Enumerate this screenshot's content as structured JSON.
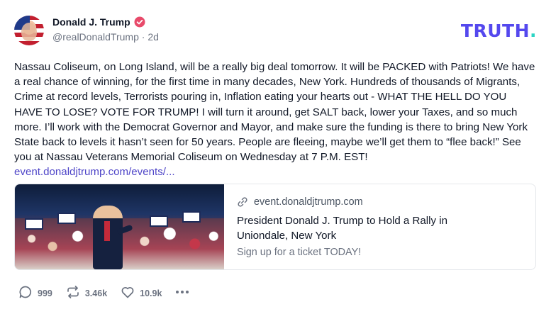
{
  "author": {
    "display_name": "Donald J. Trump",
    "handle": "@realDonaldTrump",
    "age": "2d",
    "verified": true,
    "verified_color": "#e84a6a"
  },
  "brand": {
    "name": "TRUTH",
    "dot": ".",
    "color": "#5448ee",
    "dot_color": "#2bd4c4"
  },
  "post": {
    "text": "Nassau Coliseum, on Long Island, will be a really big deal tomorrow. It will be PACKED with Patriots! We have a real chance of winning, for the first time in many decades, New York. Hundreds of thousands of Migrants, Crime at record levels, Terrorists pouring in, Inflation eating your hearts out - WHAT THE HELL DO YOU HAVE TO LOSE? VOTE FOR TRUMP! I will turn it around, get SALT back, lower your Taxes, and so much more. I’ll work with the Democrat Governor and Mayor, and make sure the funding is there to bring New York State back to levels it hasn’t seen for 50 years. People are fleeing, maybe we’ll get them to “flee back!” See you at Nassau Veterans Memorial Coliseum on Wednesday at 7 P.M. EST!",
    "link_text": "event.donaldjtrump.com/events/..."
  },
  "link_card": {
    "domain": "event.donaldjtrump.com",
    "title": "President Donald J. Trump to Hold a Rally in Uniondale, New York",
    "subtitle": "Sign up for a ticket TODAY!",
    "image_icon": "rally-photo"
  },
  "actions": {
    "replies": "999",
    "retruths": "3.46k",
    "likes": "10.9k",
    "icons": [
      "comment-icon",
      "retruth-icon",
      "heart-icon",
      "more-icon"
    ]
  }
}
